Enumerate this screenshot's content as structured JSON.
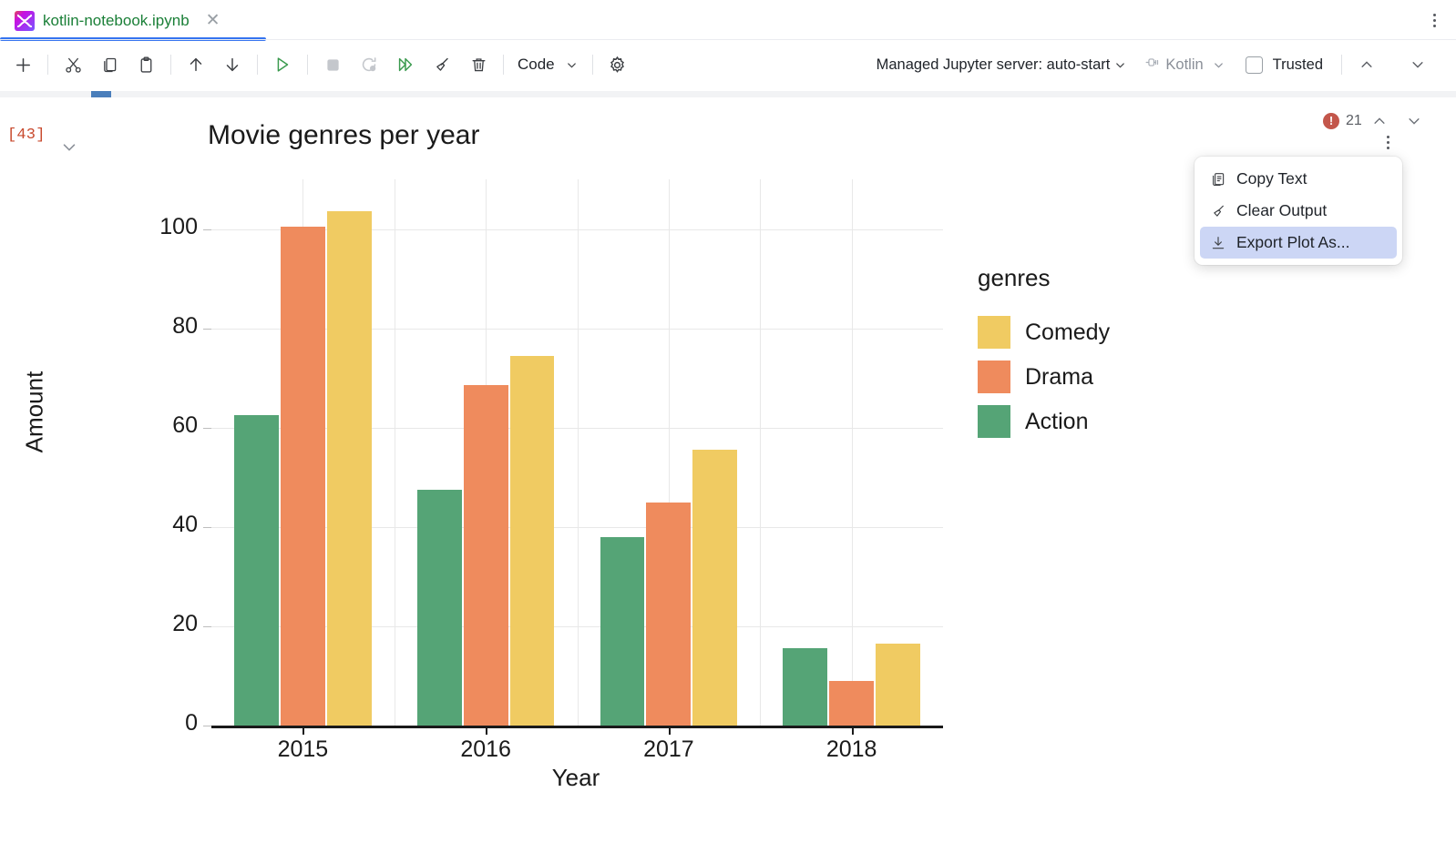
{
  "tab": {
    "title": "kotlin-notebook.ipynb",
    "icon": "kotlin-icon",
    "close_icon": "close-icon"
  },
  "toolbar": {
    "buttons": [
      {
        "name": "add-cell-button",
        "icon": "plus-icon"
      },
      {
        "name": "cut-cell-button",
        "icon": "scissors-icon"
      },
      {
        "name": "copy-cell-button",
        "icon": "copy-icon"
      },
      {
        "name": "paste-cell-button",
        "icon": "paste-icon"
      },
      {
        "name": "move-cell-up-button",
        "icon": "arrow-up-icon"
      },
      {
        "name": "move-cell-down-button",
        "icon": "arrow-down-icon"
      },
      {
        "name": "run-cell-button",
        "icon": "run-icon"
      },
      {
        "name": "interrupt-kernel-button",
        "icon": "stop-icon"
      },
      {
        "name": "restart-kernel-button",
        "icon": "restart-icon"
      },
      {
        "name": "run-all-button",
        "icon": "run-all-icon"
      },
      {
        "name": "clear-outputs-button",
        "icon": "broom-icon"
      },
      {
        "name": "delete-cell-button",
        "icon": "trash-icon"
      }
    ],
    "cell_type": "Code",
    "cell_type_chevron": "chevron-down-icon",
    "settings_icon": "gear-icon",
    "server_label": "Managed Jupyter server: auto-start",
    "kernel_label": "Kotlin",
    "kernel_icon": "plug-icon",
    "trusted_label": "Trusted",
    "trusted_checked": false,
    "nav_up_icon": "chevron-up-icon",
    "nav_down_icon": "chevron-down-icon"
  },
  "cell": {
    "execution_count": "[43]",
    "collapse_icon": "chevron-down-icon"
  },
  "output_status": {
    "error_icon": "error-icon",
    "error_mark": "!",
    "error_count": "21",
    "prev_icon": "chevron-up-icon",
    "next_icon": "chevron-down-icon",
    "kebab_icon": "more-vertical-icon"
  },
  "context_menu": {
    "items": [
      {
        "label": "Copy Text",
        "icon": "copy-icon",
        "selected": false
      },
      {
        "label": "Clear Output",
        "icon": "broom-icon",
        "selected": false
      },
      {
        "label": "Export Plot As...",
        "icon": "download-icon",
        "selected": true
      }
    ],
    "highlight_color": "#ccd6f5"
  },
  "chart_data": {
    "type": "bar",
    "title": "Movie genres per year",
    "xlabel": "Year",
    "ylabel": "Amount",
    "categories": [
      "2015",
      "2016",
      "2017",
      "2018"
    ],
    "series": [
      {
        "name": "Action",
        "color": "#55a476",
        "values": [
          62.5,
          47.5,
          38,
          15.5
        ]
      },
      {
        "name": "Drama",
        "color": "#ef8b5d",
        "values": [
          100.5,
          68.5,
          45,
          9
        ]
      },
      {
        "name": "Comedy",
        "color": "#f0cb62",
        "values": [
          103.5,
          74.5,
          55.5,
          16.5
        ]
      }
    ],
    "ylim": [
      0,
      110
    ],
    "yticks": [
      0,
      20,
      40,
      60,
      80,
      100
    ],
    "grid": true,
    "legend_title": "genres",
    "legend_position": "right",
    "legend_order": [
      "Comedy",
      "Drama",
      "Action"
    ]
  }
}
